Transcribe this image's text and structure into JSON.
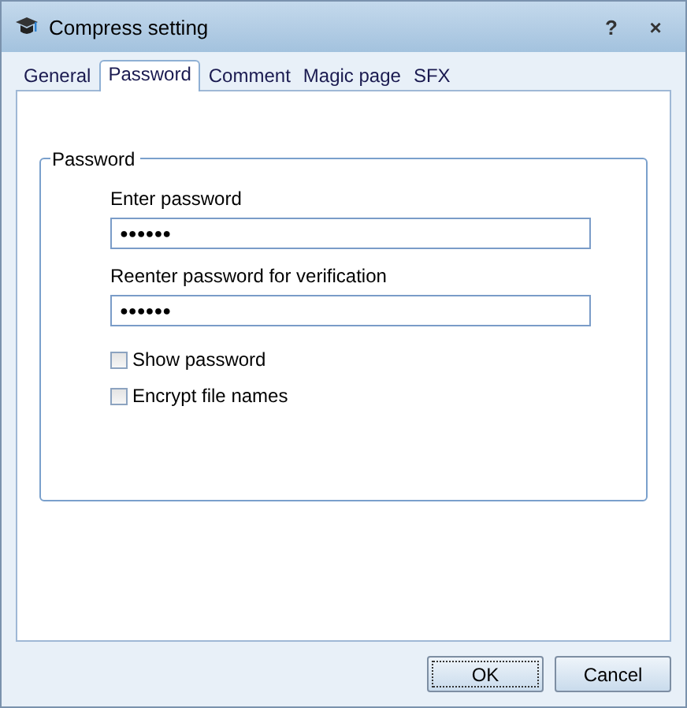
{
  "window": {
    "title": "Compress setting",
    "help": "?",
    "close": "×"
  },
  "tabs": [
    {
      "label": "General",
      "selected": false
    },
    {
      "label": "Password",
      "selected": true
    },
    {
      "label": "Comment",
      "selected": false
    },
    {
      "label": "Magic page",
      "selected": false
    },
    {
      "label": "SFX",
      "selected": false
    }
  ],
  "group": {
    "title": "Password",
    "fields": [
      {
        "label": "Enter password",
        "value": "●●●●●●"
      },
      {
        "label": "Reenter password for verification",
        "value": "●●●●●●"
      }
    ],
    "checkboxes": [
      {
        "label": "Show password",
        "checked": false
      },
      {
        "label": "Encrypt file names",
        "checked": false
      }
    ]
  },
  "buttons": [
    {
      "label": "OK",
      "default": true
    },
    {
      "label": "Cancel",
      "default": false
    }
  ]
}
